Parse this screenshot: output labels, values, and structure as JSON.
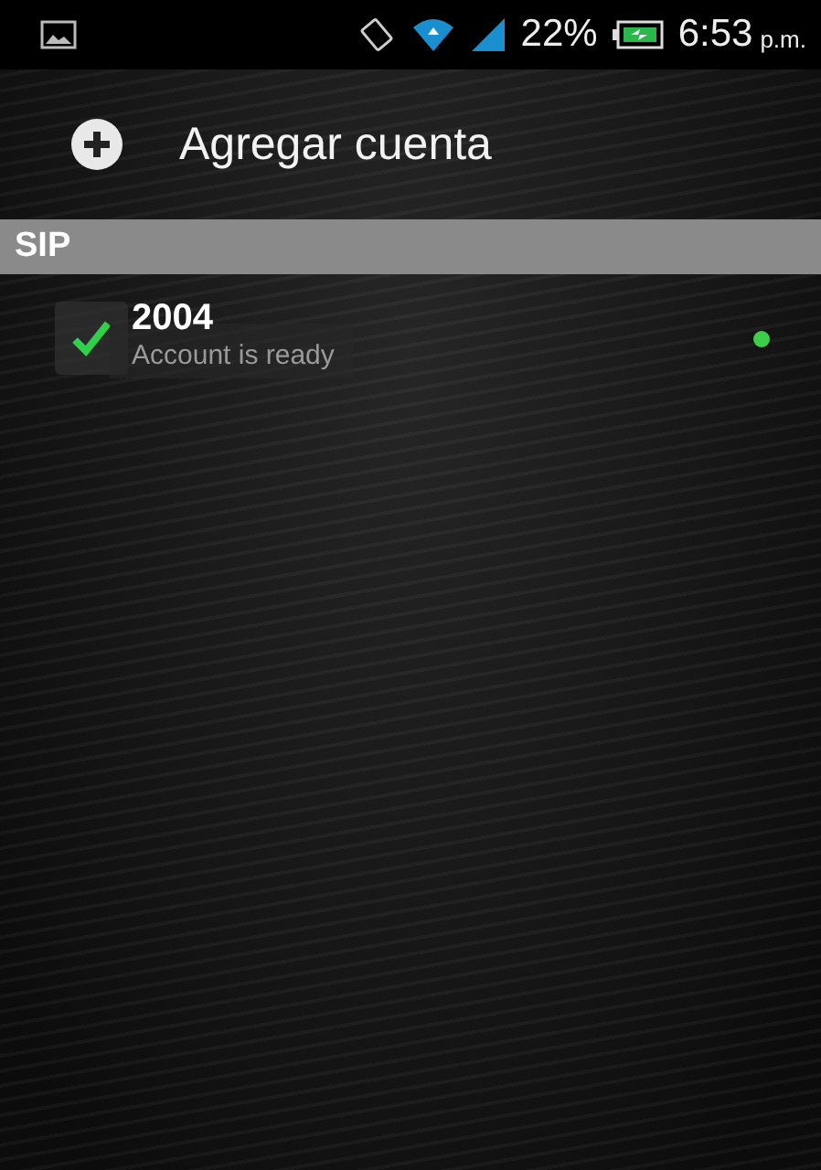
{
  "status_bar": {
    "battery_percent": "22%",
    "time": "6:53",
    "time_suffix": "p.m."
  },
  "header": {
    "title": "Agregar cuenta"
  },
  "sections": [
    {
      "title": "SIP",
      "accounts": [
        {
          "name": "2004",
          "status": "Account is ready",
          "checked": true,
          "color": "#3ecf4a"
        }
      ]
    }
  ]
}
